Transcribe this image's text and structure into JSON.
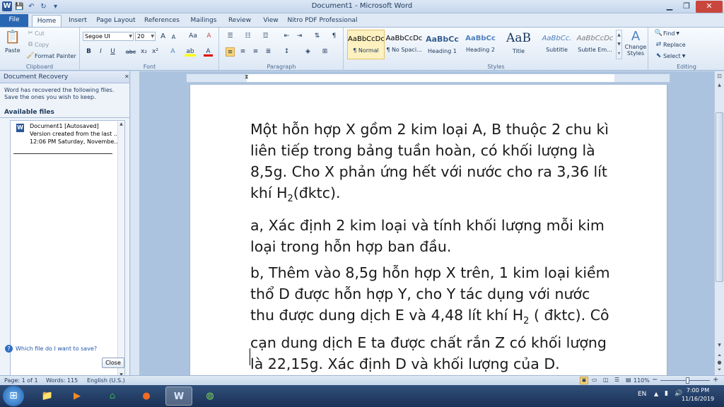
{
  "window": {
    "title": "Document1 - Microsoft Word"
  },
  "qat": {
    "logo": "W",
    "save": "💾",
    "undo": "↶",
    "redo": "↻",
    "customize": "▾"
  },
  "winbtns": {
    "minimize": "▁",
    "restore": "❐",
    "close": "✕"
  },
  "tabs": [
    "File",
    "Home",
    "Insert",
    "Page Layout",
    "References",
    "Mailings",
    "Review",
    "View",
    "Nitro PDF Professional"
  ],
  "clipboard": {
    "paste": "Paste",
    "cut": "Cut",
    "copy": "Copy",
    "format_painter": "Format Painter",
    "label": "Clipboard"
  },
  "font": {
    "name": "Segoe UI",
    "size": "20",
    "label": "Font",
    "grow": "A",
    "shrink": "A",
    "change_case": "Aa",
    "clear": "A",
    "bold": "B",
    "italic": "I",
    "underline": "U",
    "strike": "abc",
    "subscript": "x₂",
    "superscript": "x²",
    "effects": "A",
    "highlight": "ab",
    "color": "A"
  },
  "paragraph": {
    "label": "Paragraph",
    "show_marks": "¶"
  },
  "styles": {
    "label": "Styles",
    "items": [
      {
        "sample": "AaBbCcDc",
        "name": "¶ Normal"
      },
      {
        "sample": "AaBbCcDc",
        "name": "¶ No Spaci..."
      },
      {
        "sample": "AaBbCc",
        "name": "Heading 1"
      },
      {
        "sample": "AaBbCc",
        "name": "Heading 2"
      },
      {
        "sample": "AaB",
        "name": "Title"
      },
      {
        "sample": "AaBbCc.",
        "name": "Subtitle"
      },
      {
        "sample": "AaBbCcDc",
        "name": "Subtle Em..."
      }
    ],
    "change_styles": "Change Styles",
    "change_icon": "A"
  },
  "editing": {
    "find": "Find",
    "replace": "Replace",
    "select": "Select",
    "label": "Editing"
  },
  "doc_recovery": {
    "title": "Document Recovery",
    "message": "Word has recovered the following files.  Save the ones you wish to keep.",
    "available": "Available files",
    "file_name": "Document1  [Autosaved]",
    "file_line2": "Version created from the last ...",
    "file_line3": "12:06 PM Saturday, Novembe...",
    "help_link": "Which file do I want to save?",
    "close_label": "Close"
  },
  "document": {
    "p1_a": "Một hỗn hợp X gồm 2 kim loại A, B thuộc 2 chu kì liên tiếp trong bảng tuần hoàn, có khối lượng là 8,5g. Cho X phản ứng hết với nước cho ra 3,36 lít khí H",
    "p1_sub": "2",
    "p1_b": "(đktc).",
    "p2": "a, Xác định 2 kim loại và tính khối lượng mỗi kim loại trong hỗn hợp ban đầu.",
    "p3_a": "b, Thêm vào 8,5g hỗn hợp X trên, 1 kim loại kiềm thổ D được hỗn hợp Y, cho Y tác dụng với nước thu được dung dịch E và 4,48 lít khí H",
    "p3_sub": "2",
    "p3_b": " ( đktc). Cô cạn dung dịch E ta được chất rắn Z có khối lượng là 22,15g. Xác định D và khối lượng của D."
  },
  "status": {
    "page": "Page: 1 of 1",
    "words": "Words: 115",
    "language": "English (U.S.)",
    "zoom": "110%",
    "zoom_out": "−",
    "zoom_in": "+"
  },
  "taskbar": {
    "start": "⊞",
    "lang": "EN",
    "time": "7:00 PM",
    "date": "11/16/2019"
  },
  "colors": {
    "accent": "#2b579a",
    "file_tab": "#2a67b3",
    "taskbar": "#1b3157"
  }
}
